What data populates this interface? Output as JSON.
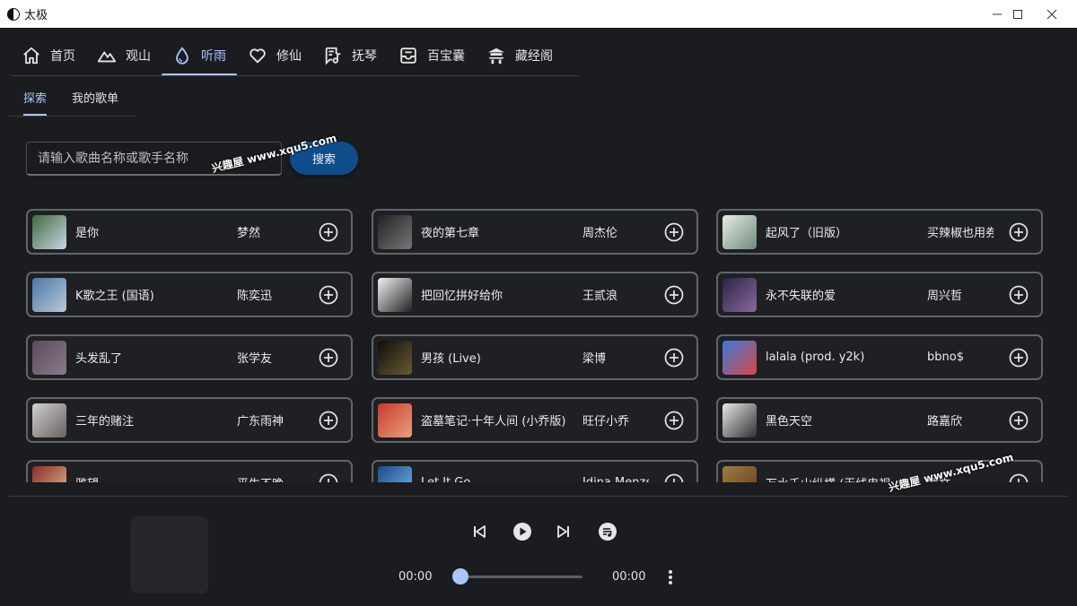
{
  "window": {
    "title": "太极"
  },
  "nav": [
    {
      "label": "首页",
      "icon": "home-icon"
    },
    {
      "label": "观山",
      "icon": "mountain-icon"
    },
    {
      "label": "听雨",
      "icon": "water-drop-icon"
    },
    {
      "label": "修仙",
      "icon": "heart-icon"
    },
    {
      "label": "抚琴",
      "icon": "lyrics-icon"
    },
    {
      "label": "百宝囊",
      "icon": "inbox-icon"
    },
    {
      "label": "藏经阁",
      "icon": "temple-icon"
    }
  ],
  "nav_active_index": 2,
  "subtabs": [
    "探索",
    "我的歌单"
  ],
  "search": {
    "placeholder": "请输入歌曲名称或歌手名称",
    "button": "搜索"
  },
  "watermark": "兴趣屋 www.xqu5.com",
  "songs": [
    {
      "title": "是你",
      "artist": "梦然",
      "cover": [
        "#3d6b3a",
        "#c9d6e8"
      ]
    },
    {
      "title": "夜的第七章",
      "artist": "周杰伦",
      "cover": [
        "#222222",
        "#777777"
      ]
    },
    {
      "title": "起风了（旧版）",
      "artist": "买辣椒也用券",
      "cover": [
        "#e8ece8",
        "#6d8a7a"
      ]
    },
    {
      "title": "K歌之王 (国语)",
      "artist": "陈奕迅",
      "cover": [
        "#4a78a8",
        "#b8c8d8"
      ]
    },
    {
      "title": "把回忆拼好给你",
      "artist": "王贰浪",
      "cover": [
        "#f2f2f2",
        "#222222"
      ]
    },
    {
      "title": "永不失联的爱",
      "artist": "周兴哲",
      "cover": [
        "#2a2440",
        "#8a6aa0"
      ]
    },
    {
      "title": "头发乱了",
      "artist": "张学友",
      "cover": [
        "#5a4a5a",
        "#8a7a8a"
      ]
    },
    {
      "title": "男孩 (Live)",
      "artist": "梁博",
      "cover": [
        "#0d0d0d",
        "#6a5a30"
      ]
    },
    {
      "title": "lalala (prod. y2k)",
      "artist": "bbno$",
      "cover": [
        "#3a7ad8",
        "#d84848"
      ]
    },
    {
      "title": "三年的赌注",
      "artist": "广东雨神",
      "cover": [
        "#d0d0d0",
        "#6a6060"
      ]
    },
    {
      "title": "盗墓笔记·十年人间 (小乔版)",
      "artist": "旺仔小乔",
      "cover": [
        "#c83a2a",
        "#e8a080"
      ]
    },
    {
      "title": "黑色天空",
      "artist": "路嘉欣",
      "cover": [
        "#e8e8e8",
        "#303030"
      ]
    },
    {
      "title": "雅望",
      "artist": "平生不晚",
      "cover": [
        "#8a2a2a",
        "#e0c090"
      ]
    },
    {
      "title": "Let It Go",
      "artist": "Idina Menzel",
      "cover": [
        "#1a4a8a",
        "#7ab8e8"
      ]
    },
    {
      "title": "万水千山纵横 (无线电视...)",
      "artist": "罗文",
      "cover": [
        "#a07a40",
        "#604020"
      ]
    }
  ],
  "player": {
    "current_time": "00:00",
    "total_time": "00:00",
    "progress": 0
  },
  "colors": {
    "accent": "#a6c8ff",
    "search_button": "#0f4d8a",
    "background": "#1b1c1f"
  }
}
